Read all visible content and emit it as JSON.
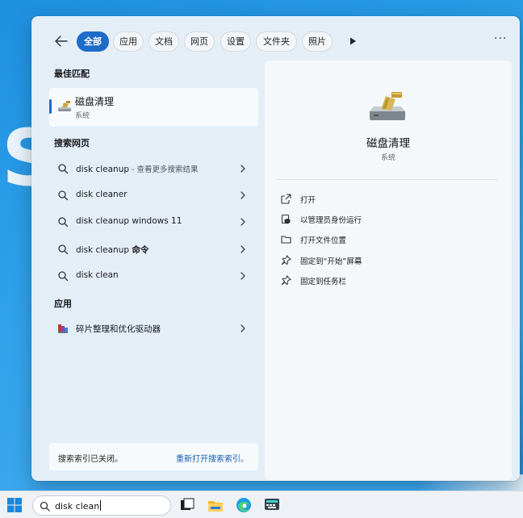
{
  "wallpaper": {
    "letter": "S"
  },
  "filters": {
    "back_label": "←",
    "chips": [
      {
        "label": "全部",
        "active": true
      },
      {
        "label": "应用",
        "active": false
      },
      {
        "label": "文档",
        "active": false
      },
      {
        "label": "网页",
        "active": false
      },
      {
        "label": "设置",
        "active": false
      },
      {
        "label": "文件夹",
        "active": false
      },
      {
        "label": "照片",
        "active": false
      }
    ],
    "more_menu": "···"
  },
  "best_match": {
    "heading": "最佳匹配",
    "name": "磁盘清理",
    "type": "系统"
  },
  "web_search": {
    "heading": "搜索网页",
    "items": [
      {
        "query": "disk cleanup",
        "suffix": " - 查看更多搜索结果",
        "bold": ""
      },
      {
        "query": "disk cleaner",
        "suffix": "",
        "bold": ""
      },
      {
        "query": "disk cleanup windows 11",
        "suffix": "",
        "bold": ""
      },
      {
        "query": "disk cleanup ",
        "suffix": "",
        "bold": "命令"
      },
      {
        "query": "disk clean",
        "suffix": "",
        "bold": ""
      }
    ]
  },
  "apps": {
    "heading": "应用",
    "items": [
      {
        "name": "碎片整理和优化驱动器"
      }
    ]
  },
  "footer": {
    "message": "搜索索引已关闭。",
    "link": "重新打开搜索索引。"
  },
  "detail": {
    "title": "磁盘清理",
    "subtitle": "系统",
    "actions": [
      {
        "label": "打开",
        "icon": "open-external-icon"
      },
      {
        "label": "以管理员身份运行",
        "icon": "shield-admin-icon"
      },
      {
        "label": "打开文件位置",
        "icon": "folder-icon"
      },
      {
        "label": "固定到“开始”屏幕",
        "icon": "pin-icon"
      },
      {
        "label": "固定到任务栏",
        "icon": "pin-icon"
      }
    ]
  },
  "taskbar": {
    "search_value": "disk clean",
    "apps": [
      "task-view-icon",
      "file-explorer-icon",
      "edge-icon",
      "keyboard-app-icon"
    ]
  },
  "colors": {
    "accent": "#1d6cc9",
    "link": "#1a5fb4"
  }
}
